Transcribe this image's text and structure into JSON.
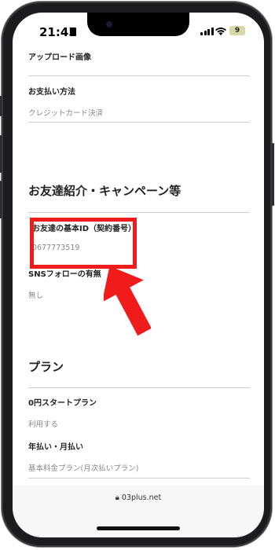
{
  "status_bar": {
    "time": "21:45",
    "battery_level": "9"
  },
  "fields": [
    {
      "label": "アップロード画像",
      "value": ""
    },
    {
      "label": "お支払い方法",
      "value": "クレジットカード決済"
    }
  ],
  "section1": {
    "heading": "お友達紹介・キャンペーン等",
    "friend_id_label": "お友達の基本ID（契約番号）",
    "friend_id_value": "0677773519",
    "sns_label": "SNSフォローの有無",
    "sns_value": "無し"
  },
  "section2": {
    "heading": "プラン",
    "plan_label": "0円スタートプラン",
    "plan_value": "利用する",
    "billing_label": "年払い・月払い",
    "billing_value": "基本料金プラン(月次払いプラン)"
  },
  "browser": {
    "url": "03plus.net"
  },
  "colors": {
    "highlight": "#f01b1b"
  }
}
